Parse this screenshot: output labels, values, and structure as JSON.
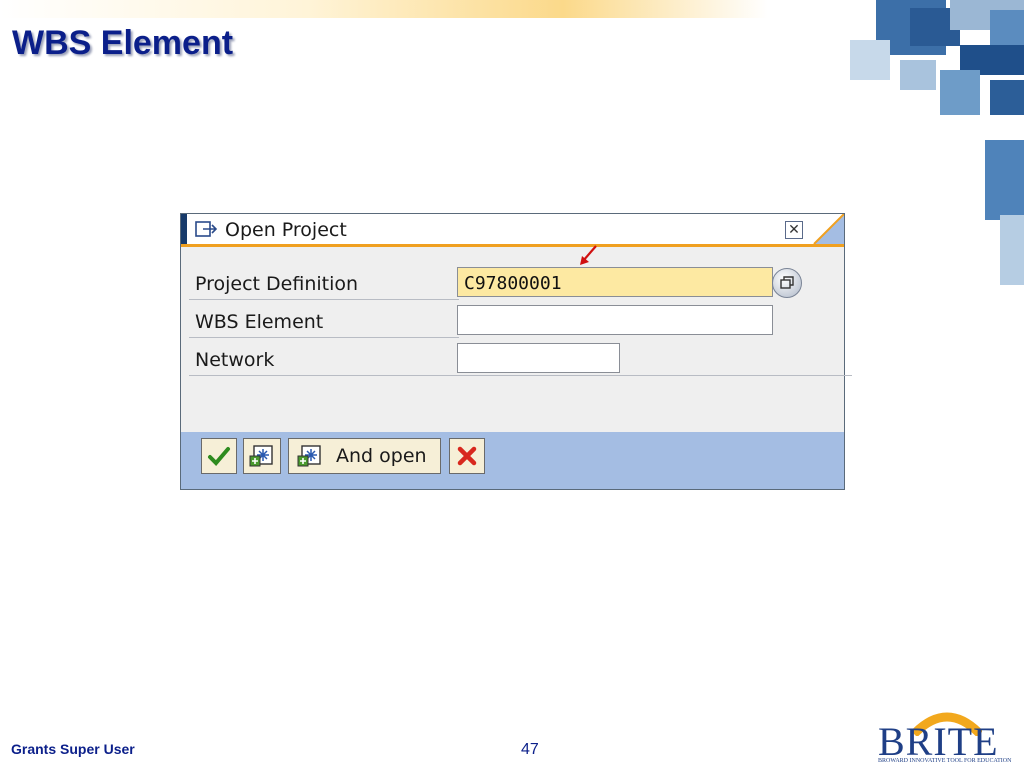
{
  "slide": {
    "title": "WBS Element",
    "footer_left": "Grants Super User",
    "page_number": "47"
  },
  "dialog": {
    "title": "Open Project",
    "icon": "open-project-icon",
    "close_icon": "close-icon",
    "fields": [
      {
        "label": "Project Definition",
        "value": "C97800001",
        "required": true
      },
      {
        "label": "WBS Element",
        "value": ""
      },
      {
        "label": "Network",
        "value": ""
      }
    ],
    "search_help_icon": "search-help-icon",
    "toolbar": {
      "continue_icon": "checkmark-icon",
      "create_icon": "create-icon",
      "create_and_open_icon": "create-icon",
      "and_open_label": "And open",
      "cancel_icon": "cancel-x-icon"
    }
  },
  "logo": {
    "name": "BRITE",
    "tagline": "BROWARD INNOVATIVE TOOL FOR EDUCATION"
  },
  "colors": {
    "title": "#0b1f8a",
    "required_field": "#fde9a2",
    "toolbar": "#a4bde3",
    "title_accent": "#f0a020"
  }
}
